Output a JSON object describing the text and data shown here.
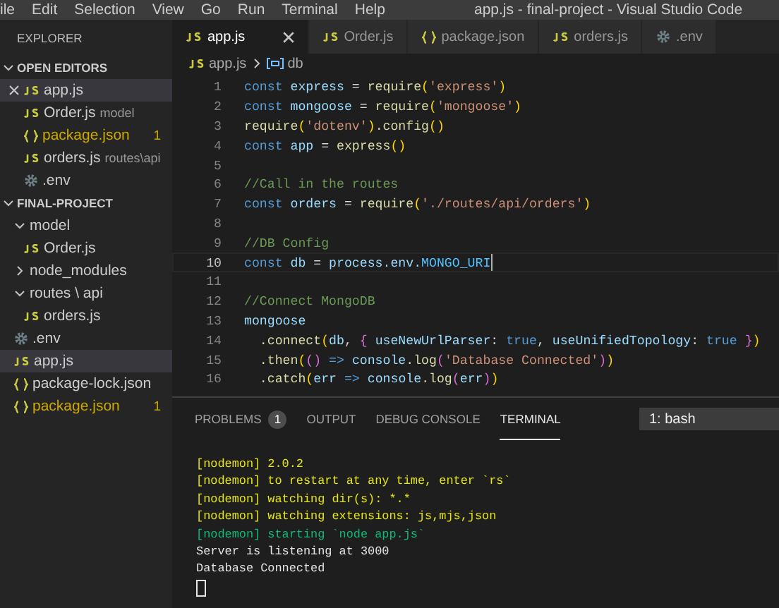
{
  "menu_bar": {
    "items": [
      "ile",
      "Edit",
      "Selection",
      "View",
      "Go",
      "Run",
      "Terminal",
      "Help"
    ],
    "title": "app.js - final-project - Visual Studio Code"
  },
  "sidebar": {
    "title": "EXPLORER",
    "open_editors": {
      "title": "OPEN EDITORS",
      "expanded": true,
      "items": [
        {
          "name": "app.js",
          "kind": "js",
          "selected": true,
          "warning": false
        },
        {
          "name": "Order.js",
          "kind": "js",
          "description": "model",
          "selected": false,
          "warning": false
        },
        {
          "name": "package.json",
          "kind": "json",
          "badge": "1",
          "selected": false,
          "warning": true
        },
        {
          "name": "orders.js",
          "kind": "js",
          "description": "routes\\api",
          "selected": false,
          "warning": false
        },
        {
          "name": ".env",
          "kind": "config",
          "selected": false,
          "warning": false
        }
      ]
    },
    "project": {
      "title": "FINAL-PROJECT",
      "expanded": true,
      "tree": [
        {
          "name": "model",
          "kind": "folder",
          "expanded": true,
          "children": [
            {
              "name": "Order.js",
              "kind": "js",
              "selected": false,
              "warning": false
            }
          ]
        },
        {
          "name": "node_modules",
          "kind": "folder",
          "expanded": false
        },
        {
          "name": "routes \\ api",
          "kind": "folder",
          "expanded": true,
          "children": [
            {
              "name": "orders.js",
              "kind": "js",
              "selected": false,
              "warning": false
            }
          ]
        },
        {
          "name": ".env",
          "kind": "config",
          "selected": false,
          "warning": false
        },
        {
          "name": "app.js",
          "kind": "js",
          "selected": true,
          "warning": false
        },
        {
          "name": "package-lock.json",
          "kind": "json",
          "selected": false,
          "warning": false
        },
        {
          "name": "package.json",
          "kind": "json",
          "badge": "1",
          "selected": false,
          "warning": true
        }
      ]
    }
  },
  "tabs": [
    {
      "name": "app.js",
      "kind": "js",
      "selected": true
    },
    {
      "name": "Order.js",
      "kind": "js",
      "selected": false
    },
    {
      "name": "package.json",
      "kind": "json",
      "selected": false
    },
    {
      "name": "orders.js",
      "kind": "js",
      "selected": false
    },
    {
      "name": ".env",
      "kind": "config",
      "selected": false
    }
  ],
  "breadcrumb": {
    "file": "app.js",
    "symbol": "db"
  },
  "code": [
    {
      "number": "1",
      "tokens": [
        {
          "kind": "kw",
          "text": "const "
        },
        {
          "kind": "var",
          "text": "express"
        },
        {
          "kind": "p",
          "text": " = "
        },
        {
          "kind": "fn",
          "text": "require"
        },
        {
          "kind": "b1",
          "text": "("
        },
        {
          "kind": "str",
          "text": "'express'"
        },
        {
          "kind": "b1",
          "text": ")"
        }
      ]
    },
    {
      "number": "2",
      "tokens": [
        {
          "kind": "kw",
          "text": "const "
        },
        {
          "kind": "var",
          "text": "mongoose"
        },
        {
          "kind": "p",
          "text": " = "
        },
        {
          "kind": "fn",
          "text": "require"
        },
        {
          "kind": "b1",
          "text": "("
        },
        {
          "kind": "str",
          "text": "'mongoose'"
        },
        {
          "kind": "b1",
          "text": ")"
        }
      ]
    },
    {
      "number": "3",
      "tokens": [
        {
          "kind": "fn",
          "text": "require"
        },
        {
          "kind": "b1",
          "text": "("
        },
        {
          "kind": "str",
          "text": "'dotenv'"
        },
        {
          "kind": "b1",
          "text": ")"
        },
        {
          "kind": "fn",
          "text": ".config"
        },
        {
          "kind": "b1",
          "text": "()"
        }
      ]
    },
    {
      "number": "4",
      "tokens": [
        {
          "kind": "kw",
          "text": "const "
        },
        {
          "kind": "var",
          "text": "app"
        },
        {
          "kind": "p",
          "text": " = "
        },
        {
          "kind": "fn",
          "text": "express"
        },
        {
          "kind": "b1",
          "text": "()"
        }
      ]
    },
    {
      "number": "5"
    },
    {
      "number": "6",
      "tokens": [
        {
          "kind": "com",
          "text": "//Call in the routes"
        }
      ]
    },
    {
      "number": "7",
      "tokens": [
        {
          "kind": "kw",
          "text": "const "
        },
        {
          "kind": "var",
          "text": "orders"
        },
        {
          "kind": "p",
          "text": " = "
        },
        {
          "kind": "fn",
          "text": "require"
        },
        {
          "kind": "b1",
          "text": "("
        },
        {
          "kind": "str",
          "text": "'./routes/api/orders'"
        },
        {
          "kind": "b1",
          "text": ")"
        }
      ]
    },
    {
      "number": "8"
    },
    {
      "number": "9",
      "tokens": [
        {
          "kind": "com",
          "text": "//DB Config"
        }
      ]
    },
    {
      "number": "10",
      "current": true,
      "tokens": [
        {
          "kind": "kw",
          "text": "const "
        },
        {
          "kind": "var",
          "text": "db"
        },
        {
          "kind": "p",
          "text": " = "
        },
        {
          "kind": "var",
          "text": "process.env."
        },
        {
          "kind": "const",
          "text": "MONGO_URI"
        }
      ]
    },
    {
      "number": "11"
    },
    {
      "number": "12",
      "tokens": [
        {
          "kind": "com",
          "text": "//Connect MongoDB"
        }
      ]
    },
    {
      "number": "13",
      "tokens": [
        {
          "kind": "var",
          "text": "mongoose"
        }
      ]
    },
    {
      "number": "14",
      "tokens": [
        {
          "kind": "fn",
          "text": "  .connect"
        },
        {
          "kind": "b1",
          "text": "("
        },
        {
          "kind": "var",
          "text": "db"
        },
        {
          "kind": "p",
          "text": ", "
        },
        {
          "kind": "b2",
          "text": "{ "
        },
        {
          "kind": "var",
          "text": "useNewUrlParser"
        },
        {
          "kind": "p",
          "text": ": "
        },
        {
          "kind": "kw",
          "text": "true"
        },
        {
          "kind": "p",
          "text": ", "
        },
        {
          "kind": "var",
          "text": "useUnifiedTopology"
        },
        {
          "kind": "p",
          "text": ": "
        },
        {
          "kind": "kw",
          "text": "true "
        },
        {
          "kind": "b2",
          "text": "}"
        },
        {
          "kind": "b1",
          "text": ")"
        }
      ]
    },
    {
      "number": "15",
      "tokens": [
        {
          "kind": "fn",
          "text": "  .then"
        },
        {
          "kind": "b1",
          "text": "("
        },
        {
          "kind": "b2",
          "text": "()"
        },
        {
          "kind": "kw",
          "text": " => "
        },
        {
          "kind": "var",
          "text": "console"
        },
        {
          "kind": "fn",
          "text": ".log"
        },
        {
          "kind": "b2",
          "text": "("
        },
        {
          "kind": "str",
          "text": "'Database Connected'"
        },
        {
          "kind": "b2",
          "text": ")"
        },
        {
          "kind": "b1",
          "text": ")"
        }
      ]
    },
    {
      "number": "16",
      "tokens": [
        {
          "kind": "fn",
          "text": "  .catch"
        },
        {
          "kind": "b1",
          "text": "("
        },
        {
          "kind": "var",
          "text": "err"
        },
        {
          "kind": "kw",
          "text": " => "
        },
        {
          "kind": "var",
          "text": "console"
        },
        {
          "kind": "fn",
          "text": ".log"
        },
        {
          "kind": "b2",
          "text": "("
        },
        {
          "kind": "var",
          "text": "err"
        },
        {
          "kind": "b2",
          "text": ")"
        },
        {
          "kind": "b1",
          "text": ")"
        }
      ]
    }
  ],
  "panel": {
    "tabs": [
      {
        "label": "PROBLEMS",
        "badge": "1",
        "selected": false
      },
      {
        "label": "OUTPUT",
        "selected": false
      },
      {
        "label": "DEBUG CONSOLE",
        "selected": false
      },
      {
        "label": "TERMINAL",
        "selected": true
      }
    ],
    "terminal_select": "1: bash",
    "terminal": [
      {
        "text": "[nodemon] 2.0.2",
        "kind": "yellow"
      },
      {
        "text": "[nodemon] to restart at any time, enter `rs`",
        "kind": "yellow"
      },
      {
        "text": "[nodemon] watching dir(s): *.*",
        "kind": "yellow"
      },
      {
        "text": "[nodemon] watching extensions: js,mjs,json",
        "kind": "yellow"
      },
      {
        "text": "[nodemon] starting `node app.js`",
        "kind": "green"
      },
      {
        "text": "Server is listening at 3000",
        "kind": "plain"
      },
      {
        "text": "Database Connected",
        "kind": "plain"
      }
    ],
    "cursor": true
  }
}
